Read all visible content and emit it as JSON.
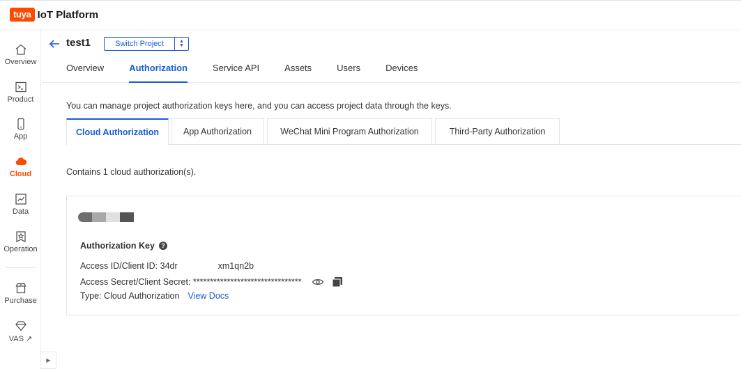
{
  "brand": {
    "logo_badge": "tuya",
    "platform_name": "IoT Platform",
    "accent": "#ff4800"
  },
  "sidebar": {
    "items": [
      {
        "label": "Overview",
        "icon": "home-icon"
      },
      {
        "label": "Product",
        "icon": "terminal-icon"
      },
      {
        "label": "App",
        "icon": "phone-icon"
      },
      {
        "label": "Cloud",
        "icon": "cloud-icon",
        "active": true
      },
      {
        "label": "Data",
        "icon": "chart-icon"
      },
      {
        "label": "Operation",
        "icon": "star-badge-icon"
      },
      {
        "label": "Purchase",
        "icon": "store-icon"
      },
      {
        "label": "VAS ↗",
        "icon": "diamond-icon"
      }
    ],
    "collapse_glyph": "▶"
  },
  "project": {
    "name": "test1",
    "switch_label": "Switch Project",
    "tabs": [
      "Overview",
      "Authorization",
      "Service API",
      "Assets",
      "Users",
      "Devices"
    ],
    "active_tab": "Authorization"
  },
  "authorization": {
    "description": "You can manage project authorization keys here, and you can access project data through the keys.",
    "subtabs": [
      "Cloud Authorization",
      "App Authorization",
      "WeChat Mini Program Authorization",
      "Third-Party Authorization"
    ],
    "active_subtab": "Cloud Authorization",
    "count_text": "Contains 1 cloud authorization(s).",
    "card": {
      "key_title": "Authorization Key",
      "help_glyph": "?",
      "access_id_prefix": "Access ID/Client ID: 34dr",
      "access_id_suffix": "xm1qn2b",
      "access_secret": "Access Secret/Client Secret: ********************************",
      "type_text": "Type: Cloud Authorization",
      "view_docs": "View Docs"
    }
  },
  "colors": {
    "link_blue": "#1a5bd6",
    "border": "#e3e3e3"
  }
}
